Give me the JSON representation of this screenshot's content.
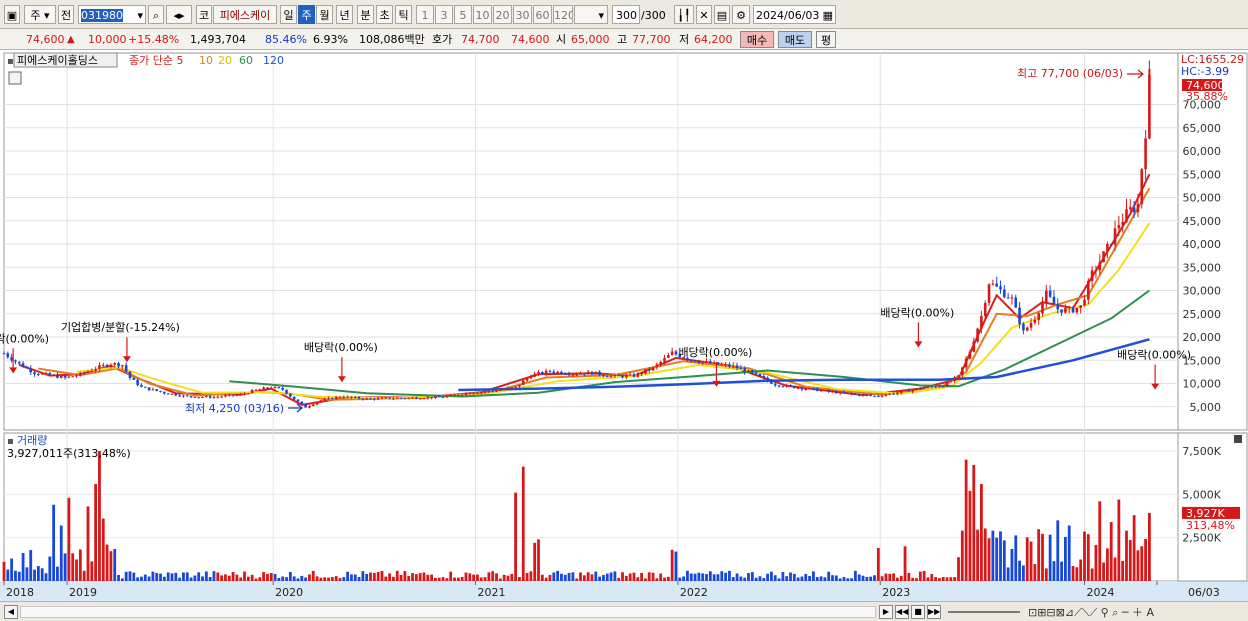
{
  "toolbar": {
    "market": "주",
    "prev": "전",
    "code": "031980",
    "market_code": "코",
    "stock_name": "피에스케이",
    "periods": [
      "일",
      "주",
      "월",
      "년",
      "분",
      "초",
      "틱"
    ],
    "selected_period": "주",
    "intervals": [
      "1",
      "3",
      "5",
      "10",
      "20",
      "30",
      "60",
      "120"
    ],
    "count": "300",
    "count_total": "/300",
    "date": "2024/06/03"
  },
  "quote": {
    "price": "74,600",
    "arrow": "▲",
    "change": "10,000",
    "change_pct": "+15.48%",
    "volume": "1,493,704",
    "ratio1": "85.46%",
    "ratio2": "6.93%",
    "amount": "108,086백만",
    "ask_label": "호가",
    "ask1": "74,700",
    "ask2": "74,600",
    "open_label": "시",
    "open": "65,000",
    "high_label": "고",
    "high": "77,700",
    "low_label": "저",
    "low": "64,200",
    "buy": "매수",
    "sell": "매도",
    "eval": "평"
  },
  "price_panel": {
    "name": "피에스케이홀딩스",
    "legend_prefix": "종가 단순",
    "ma_periods": [
      "5",
      "10",
      "20",
      "60",
      "120"
    ],
    "ma_colors": [
      "#d82020",
      "#e08020",
      "#f0e020",
      "#2f8f4f",
      "#2050d8"
    ],
    "lc": "LC:1655.29",
    "hc": "HC:-3.99",
    "current": "74,600",
    "current_pct": "35.88%",
    "high_note": "최고 77,700 (06/03)",
    "low_note": "최저 4,250 (03/16)",
    "events": [
      {
        "label": "배당락(0.00%)",
        "w": 2.4,
        "p": 11100
      },
      {
        "label": "기업합병/분할(-15.24%)",
        "w": 32.2,
        "p": 13500
      },
      {
        "label": "배당락(0.00%)",
        "w": 88.5,
        "p": 9200
      },
      {
        "label": "배당락(0.00%)",
        "w": 186.6,
        "p": 8200
      },
      {
        "label": "배당락(0.00%)",
        "w": 239.5,
        "p": 16700
      },
      {
        "label": "배당락(0.00%)",
        "w": 301.5,
        "p": 7600
      },
      {
        "label": "배당락(0.00%)",
        "w": 355.5,
        "p": 28300
      }
    ]
  },
  "volume_panel": {
    "title": "거래량",
    "summary": "3,927,011주(313,48%)",
    "current": "3,927K",
    "current_pct": "313,48%"
  },
  "chart_data": {
    "type": "candlestick",
    "price_axis": {
      "min": 0,
      "max": 80000,
      "ticks": [
        5000,
        10000,
        15000,
        20000,
        25000,
        30000,
        35000,
        40000,
        45000,
        50000,
        55000,
        60000,
        65000,
        70000
      ]
    },
    "volume_axis": {
      "min": 0,
      "max": 8000000,
      "ticks": [
        2500000,
        5000000,
        7500000
      ],
      "tick_labels": [
        "2,500K",
        "5,000K",
        "7,500K"
      ]
    },
    "x_axis_labels": [
      {
        "w": 0,
        "label": "2018"
      },
      {
        "w": 16.5,
        "label": "2019"
      },
      {
        "w": 70.5,
        "label": "2020"
      },
      {
        "w": 123.5,
        "label": "2021"
      },
      {
        "w": 176.5,
        "label": "2022"
      },
      {
        "w": 229.5,
        "label": "2023"
      },
      {
        "w": 283,
        "label": "2024"
      },
      {
        "w": 302,
        "label": "06/03"
      }
    ],
    "weeks_shown": 300,
    "price_path": [
      {
        "w": 0,
        "p": 16500
      },
      {
        "w": 4,
        "p": 14200
      },
      {
        "w": 8,
        "p": 12300
      },
      {
        "w": 12,
        "p": 11800
      },
      {
        "w": 16,
        "p": 11200
      },
      {
        "w": 20,
        "p": 12000
      },
      {
        "w": 24,
        "p": 13300
      },
      {
        "w": 28,
        "p": 14300
      },
      {
        "w": 31,
        "p": 14000
      },
      {
        "w": 33,
        "p": 11200
      },
      {
        "w": 36,
        "p": 9200
      },
      {
        "w": 42,
        "p": 8000
      },
      {
        "w": 48,
        "p": 7200
      },
      {
        "w": 55,
        "p": 7100
      },
      {
        "w": 62,
        "p": 7600
      },
      {
        "w": 66,
        "p": 8600
      },
      {
        "w": 70,
        "p": 9200
      },
      {
        "w": 73,
        "p": 8700
      },
      {
        "w": 76,
        "p": 6600
      },
      {
        "w": 79,
        "p": 4900
      },
      {
        "w": 83,
        "p": 6400
      },
      {
        "w": 88,
        "p": 7200
      },
      {
        "w": 95,
        "p": 6700
      },
      {
        "w": 105,
        "p": 6900
      },
      {
        "w": 115,
        "p": 7100
      },
      {
        "w": 122,
        "p": 8000
      },
      {
        "w": 128,
        "p": 8400
      },
      {
        "w": 134,
        "p": 9200
      },
      {
        "w": 138,
        "p": 11800
      },
      {
        "w": 143,
        "p": 12600
      },
      {
        "w": 149,
        "p": 12100
      },
      {
        "w": 154,
        "p": 12300
      },
      {
        "w": 160,
        "p": 11500
      },
      {
        "w": 165,
        "p": 11700
      },
      {
        "w": 170,
        "p": 13300
      },
      {
        "w": 175,
        "p": 16600
      },
      {
        "w": 180,
        "p": 15100
      },
      {
        "w": 186,
        "p": 14200
      },
      {
        "w": 191,
        "p": 13700
      },
      {
        "w": 196,
        "p": 12200
      },
      {
        "w": 202,
        "p": 9800
      },
      {
        "w": 208,
        "p": 9100
      },
      {
        "w": 214,
        "p": 8500
      },
      {
        "w": 220,
        "p": 7900
      },
      {
        "w": 228,
        "p": 7300
      },
      {
        "w": 234,
        "p": 8000
      },
      {
        "w": 240,
        "p": 9000
      },
      {
        "w": 246,
        "p": 9600
      },
      {
        "w": 250,
        "p": 11500
      },
      {
        "w": 253,
        "p": 17000
      },
      {
        "w": 256,
        "p": 24500
      },
      {
        "w": 258,
        "p": 31800
      },
      {
        "w": 261,
        "p": 30000
      },
      {
        "w": 264,
        "p": 28100
      },
      {
        "w": 267,
        "p": 21000
      },
      {
        "w": 270,
        "p": 24200
      },
      {
        "w": 273,
        "p": 29200
      },
      {
        "w": 276,
        "p": 26000
      },
      {
        "w": 279,
        "p": 25700
      },
      {
        "w": 282,
        "p": 26500
      },
      {
        "w": 285,
        "p": 33500
      },
      {
        "w": 289,
        "p": 39000
      },
      {
        "w": 292,
        "p": 44500
      },
      {
        "w": 295,
        "p": 47200
      },
      {
        "w": 297,
        "p": 48500
      },
      {
        "w": 299,
        "p": 64600
      },
      {
        "w": 300,
        "p": 74600
      }
    ],
    "ma_lines": [
      {
        "period": 5,
        "points": [
          {
            "w": 4,
            "p": 14000
          },
          {
            "w": 12,
            "p": 11700
          },
          {
            "w": 20,
            "p": 12000
          },
          {
            "w": 28,
            "p": 13800
          },
          {
            "w": 34,
            "p": 11500
          },
          {
            "w": 45,
            "p": 7900
          },
          {
            "w": 62,
            "p": 7600
          },
          {
            "w": 70,
            "p": 8900
          },
          {
            "w": 78,
            "p": 5400
          },
          {
            "w": 90,
            "p": 7000
          },
          {
            "w": 110,
            "p": 7000
          },
          {
            "w": 125,
            "p": 8100
          },
          {
            "w": 140,
            "p": 12000
          },
          {
            "w": 155,
            "p": 12200
          },
          {
            "w": 165,
            "p": 11600
          },
          {
            "w": 176,
            "p": 15500
          },
          {
            "w": 190,
            "p": 13800
          },
          {
            "w": 205,
            "p": 9500
          },
          {
            "w": 225,
            "p": 7500
          },
          {
            "w": 240,
            "p": 8900
          },
          {
            "w": 250,
            "p": 11000
          },
          {
            "w": 256,
            "p": 22000
          },
          {
            "w": 260,
            "p": 29000
          },
          {
            "w": 266,
            "p": 24000
          },
          {
            "w": 272,
            "p": 27500
          },
          {
            "w": 280,
            "p": 26200
          },
          {
            "w": 288,
            "p": 37000
          },
          {
            "w": 295,
            "p": 46500
          },
          {
            "w": 300,
            "p": 55000
          }
        ]
      },
      {
        "period": 10,
        "points": [
          {
            "w": 9,
            "p": 13200
          },
          {
            "w": 20,
            "p": 11800
          },
          {
            "w": 30,
            "p": 13300
          },
          {
            "w": 38,
            "p": 10000
          },
          {
            "w": 50,
            "p": 7400
          },
          {
            "w": 66,
            "p": 8200
          },
          {
            "w": 75,
            "p": 7800
          },
          {
            "w": 85,
            "p": 6500
          },
          {
            "w": 110,
            "p": 6900
          },
          {
            "w": 128,
            "p": 8200
          },
          {
            "w": 142,
            "p": 11300
          },
          {
            "w": 160,
            "p": 11800
          },
          {
            "w": 178,
            "p": 14800
          },
          {
            "w": 195,
            "p": 13300
          },
          {
            "w": 210,
            "p": 9300
          },
          {
            "w": 230,
            "p": 7600
          },
          {
            "w": 245,
            "p": 9000
          },
          {
            "w": 252,
            "p": 12500
          },
          {
            "w": 260,
            "p": 25000
          },
          {
            "w": 268,
            "p": 24500
          },
          {
            "w": 276,
            "p": 27000
          },
          {
            "w": 284,
            "p": 29000
          },
          {
            "w": 292,
            "p": 40500
          },
          {
            "w": 300,
            "p": 52000
          }
        ]
      },
      {
        "period": 20,
        "points": [
          {
            "w": 19,
            "p": 12500
          },
          {
            "w": 30,
            "p": 13500
          },
          {
            "w": 40,
            "p": 10800
          },
          {
            "w": 52,
            "p": 8000
          },
          {
            "w": 70,
            "p": 8100
          },
          {
            "w": 82,
            "p": 7200
          },
          {
            "w": 100,
            "p": 6800
          },
          {
            "w": 125,
            "p": 7600
          },
          {
            "w": 145,
            "p": 10500
          },
          {
            "w": 165,
            "p": 11600
          },
          {
            "w": 182,
            "p": 14000
          },
          {
            "w": 200,
            "p": 12300
          },
          {
            "w": 218,
            "p": 8800
          },
          {
            "w": 235,
            "p": 7800
          },
          {
            "w": 248,
            "p": 9300
          },
          {
            "w": 256,
            "p": 14500
          },
          {
            "w": 264,
            "p": 22000
          },
          {
            "w": 274,
            "p": 25000
          },
          {
            "w": 284,
            "p": 27000
          },
          {
            "w": 292,
            "p": 34500
          },
          {
            "w": 300,
            "p": 44500
          }
        ]
      },
      {
        "period": 60,
        "points": [
          {
            "w": 59,
            "p": 10500
          },
          {
            "w": 75,
            "p": 9400
          },
          {
            "w": 95,
            "p": 7900
          },
          {
            "w": 120,
            "p": 7200
          },
          {
            "w": 140,
            "p": 8000
          },
          {
            "w": 160,
            "p": 10300
          },
          {
            "w": 180,
            "p": 11500
          },
          {
            "w": 200,
            "p": 12800
          },
          {
            "w": 220,
            "p": 11400
          },
          {
            "w": 240,
            "p": 9600
          },
          {
            "w": 250,
            "p": 9400
          },
          {
            "w": 262,
            "p": 13000
          },
          {
            "w": 276,
            "p": 18500
          },
          {
            "w": 290,
            "p": 24000
          },
          {
            "w": 300,
            "p": 30000
          }
        ]
      },
      {
        "period": 120,
        "points": [
          {
            "w": 119,
            "p": 8600
          },
          {
            "w": 140,
            "p": 8900
          },
          {
            "w": 160,
            "p": 9300
          },
          {
            "w": 180,
            "p": 9900
          },
          {
            "w": 200,
            "p": 10600
          },
          {
            "w": 220,
            "p": 10800
          },
          {
            "w": 245,
            "p": 10800
          },
          {
            "w": 260,
            "p": 11400
          },
          {
            "w": 280,
            "p": 15000
          },
          {
            "w": 300,
            "p": 19500
          }
        ]
      }
    ],
    "volume_spikes": [
      {
        "w": 13,
        "v": 4400000
      },
      {
        "w": 15,
        "v": 3200000
      },
      {
        "w": 17,
        "v": 4800000
      },
      {
        "w": 22,
        "v": 4300000
      },
      {
        "w": 24,
        "v": 5600000
      },
      {
        "w": 25,
        "v": 7500000
      },
      {
        "w": 26,
        "v": 3600000
      },
      {
        "w": 27,
        "v": 2100000
      },
      {
        "w": 134,
        "v": 5100000
      },
      {
        "w": 136,
        "v": 6600000
      },
      {
        "w": 139,
        "v": 2200000
      },
      {
        "w": 140,
        "v": 2400000
      },
      {
        "w": 175,
        "v": 1800000
      },
      {
        "w": 176,
        "v": 1700000
      },
      {
        "w": 229,
        "v": 1900000
      },
      {
        "w": 236,
        "v": 2000000
      },
      {
        "w": 252,
        "v": 7000000
      },
      {
        "w": 253,
        "v": 5200000
      },
      {
        "w": 254,
        "v": 6700000
      },
      {
        "w": 256,
        "v": 5600000
      },
      {
        "w": 259,
        "v": 2900000
      },
      {
        "w": 260,
        "v": 2500000
      },
      {
        "w": 276,
        "v": 3500000
      },
      {
        "w": 279,
        "v": 3200000
      },
      {
        "w": 284,
        "v": 2700000
      },
      {
        "w": 287,
        "v": 4600000
      },
      {
        "w": 290,
        "v": 3400000
      },
      {
        "w": 292,
        "v": 4700000
      },
      {
        "w": 296,
        "v": 3800000
      },
      {
        "w": 298,
        "v": 2000000
      },
      {
        "w": 300,
        "v": 3927011
      }
    ]
  }
}
